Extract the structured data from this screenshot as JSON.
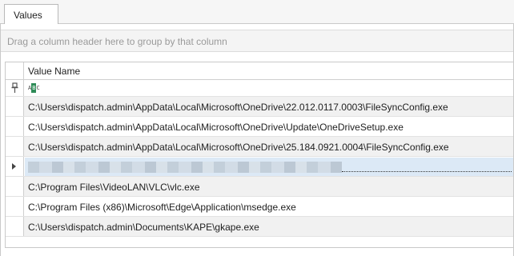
{
  "tabs": [
    {
      "label": "Values"
    }
  ],
  "group_panel": {
    "hint": "Drag a column header here to group by that column"
  },
  "grid": {
    "columns": [
      {
        "label": "Value Name"
      }
    ],
    "filter_row": {
      "icon": "pin-icon",
      "operator_icon": "abc-icon",
      "operator_text": {
        "a": "A",
        "b": "B",
        "c": "C"
      }
    },
    "rows": [
      {
        "value": "C:\\Users\\dispatch.admin\\AppData\\Local\\Microsoft\\OneDrive\\22.012.0117.0003\\FileSyncConfig.exe"
      },
      {
        "value": "C:\\Users\\dispatch.admin\\AppData\\Local\\Microsoft\\OneDrive\\Update\\OneDriveSetup.exe"
      },
      {
        "value": "C:\\Users\\dispatch.admin\\AppData\\Local\\Microsoft\\OneDrive\\25.184.0921.0004\\FileSyncConfig.exe"
      },
      {
        "value": "",
        "redacted": true,
        "selected": true
      },
      {
        "value": "C:\\Program Files\\VideoLAN\\VLC\\vlc.exe"
      },
      {
        "value": "C:\\Program Files (x86)\\Microsoft\\Edge\\Application\\msedge.exe"
      },
      {
        "value": "C:\\Users\\dispatch.admin\\Documents\\KAPE\\gkape.exe"
      }
    ]
  },
  "colors": {
    "selection": "#dce9f6",
    "alt_row": "#f1f1f1",
    "grid_line": "#cfcfcf"
  }
}
